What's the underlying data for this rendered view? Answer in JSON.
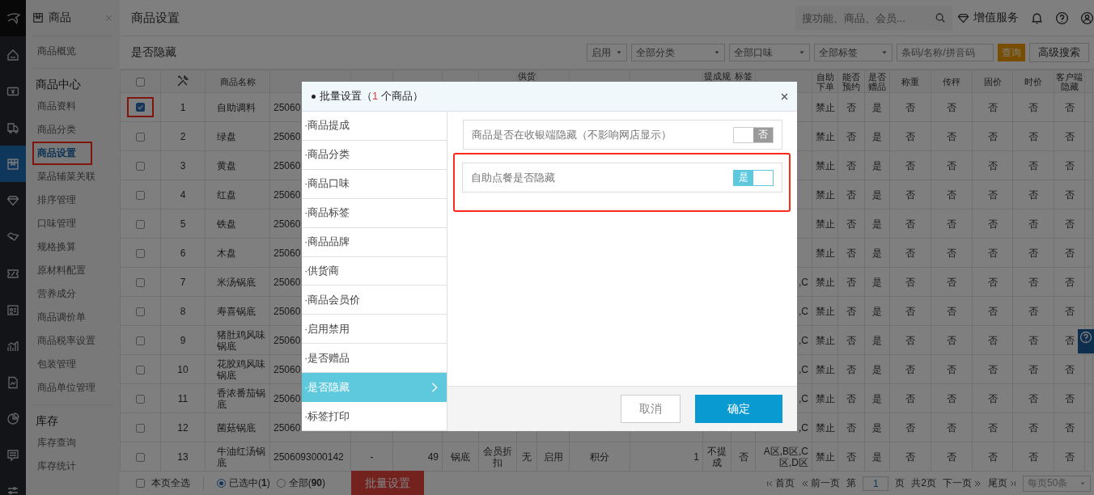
{
  "rail": [
    {
      "selected": false
    },
    {
      "selected": false
    },
    {
      "selected": false
    },
    {
      "selected": true
    },
    {
      "selected": false
    },
    {
      "selected": false
    },
    {
      "selected": false
    },
    {
      "selected": false
    },
    {
      "selected": false
    },
    {
      "selected": false
    },
    {
      "selected": false
    },
    {
      "selected": false
    },
    {
      "selected": false
    }
  ],
  "subnav": {
    "title": "商品",
    "sections": [
      {
        "items": [
          {
            "label": "商品概览",
            "selected": false,
            "highlighted": false
          }
        ]
      },
      {
        "title": "商品中心",
        "items": [
          {
            "label": "商品资料",
            "selected": false,
            "highlighted": false
          },
          {
            "label": "商品分类",
            "selected": false,
            "highlighted": false
          },
          {
            "label": "商品设置",
            "selected": true,
            "highlighted": true
          },
          {
            "label": "菜品辅菜关联",
            "selected": false,
            "highlighted": false
          },
          {
            "label": "排序管理",
            "selected": false,
            "highlighted": false
          },
          {
            "label": "口味管理",
            "selected": false,
            "highlighted": false
          },
          {
            "label": "规格换算",
            "selected": false,
            "highlighted": false
          },
          {
            "label": "原材料配置",
            "selected": false,
            "highlighted": false
          },
          {
            "label": "营养成分",
            "selected": false,
            "highlighted": false
          },
          {
            "label": "商品调价单",
            "selected": false,
            "highlighted": false
          },
          {
            "label": "商品税率设置",
            "selected": false,
            "highlighted": false
          },
          {
            "label": "包装管理",
            "selected": false,
            "highlighted": false
          },
          {
            "label": "商品单位管理",
            "selected": false,
            "highlighted": false
          }
        ]
      },
      {
        "title": "库存",
        "items": [
          {
            "label": "库存查询",
            "selected": false,
            "highlighted": false
          },
          {
            "label": "库存统计",
            "selected": false,
            "highlighted": false
          }
        ]
      }
    ]
  },
  "header": {
    "title": "商品设置",
    "search": {
      "placeholder": "搜功能、商品、会员..."
    },
    "service": "增值服务"
  },
  "toolbar": {
    "title": "是否隐藏",
    "filters": [
      "启用",
      "全部分类",
      "全部口味",
      "全部标签"
    ],
    "search": {
      "placeholder": "条码/名称/拼音码"
    },
    "query": "查询",
    "advanced": "高级搜索"
  },
  "table": {
    "columns": [
      {
        "kind": "checkbox",
        "checked": false
      },
      {
        "kind": "tools"
      },
      {
        "kind": "text",
        "label": "商品名称"
      },
      {
        "kind": "text"
      },
      {
        "kind": "text"
      },
      {
        "kind": "text"
      },
      {
        "kind": "text"
      },
      {
        "kind": "text"
      },
      {
        "kind": "cut",
        "label": "供货"
      },
      {
        "kind": "text"
      },
      {
        "kind": "text"
      },
      {
        "kind": "text"
      },
      {
        "kind": "cut",
        "label": "提成规"
      },
      {
        "kind": "cut",
        "label": "标签"
      },
      {
        "kind": "text"
      },
      {
        "kind": "text",
        "label": "自助下单"
      },
      {
        "kind": "text",
        "label": "能否预约"
      },
      {
        "kind": "text",
        "label": "是否赠品"
      },
      {
        "kind": "text",
        "label": "称重"
      },
      {
        "kind": "text",
        "label": "传秤"
      },
      {
        "kind": "text",
        "label": "固价"
      },
      {
        "kind": "text",
        "label": "时价"
      },
      {
        "kind": "text",
        "label": "客户端隐藏"
      },
      {
        "kind": "text"
      }
    ],
    "rows": [
      {
        "checked": true,
        "highlighted": true,
        "cells": [
          null,
          "1",
          "自助调料",
          "25060",
          null,
          null,
          null,
          null,
          null,
          null,
          null,
          null,
          null,
          null,
          null,
          "禁止",
          "否",
          "是",
          "否",
          "否",
          "否",
          "否",
          "否"
        ]
      },
      {
        "checked": false,
        "highlighted": false,
        "cells": [
          null,
          "2",
          "绿盘",
          "25060",
          null,
          null,
          null,
          null,
          null,
          null,
          null,
          null,
          null,
          null,
          null,
          "禁止",
          "否",
          "是",
          "否",
          "否",
          "否",
          "否",
          "否"
        ]
      },
      {
        "checked": false,
        "highlighted": false,
        "cells": [
          null,
          "3",
          "黄盘",
          "25060",
          null,
          null,
          null,
          null,
          null,
          null,
          null,
          null,
          null,
          null,
          null,
          "禁止",
          "否",
          "是",
          "否",
          "否",
          "否",
          "否",
          "否"
        ]
      },
      {
        "checked": false,
        "highlighted": false,
        "cells": [
          null,
          "4",
          "红盘",
          "25060",
          null,
          null,
          null,
          null,
          null,
          null,
          null,
          null,
          null,
          null,
          null,
          "禁止",
          "否",
          "是",
          "否",
          "否",
          "否",
          "否",
          "否"
        ]
      },
      {
        "checked": false,
        "highlighted": false,
        "cells": [
          null,
          "5",
          "铁盘",
          "25060",
          null,
          null,
          null,
          null,
          null,
          null,
          null,
          null,
          null,
          null,
          null,
          "禁止",
          "否",
          "是",
          "否",
          "否",
          "否",
          "否",
          "否"
        ]
      },
      {
        "checked": false,
        "highlighted": false,
        "cells": [
          null,
          "6",
          "木盘",
          "25060",
          null,
          null,
          null,
          null,
          null,
          null,
          null,
          null,
          null,
          null,
          null,
          "禁止",
          "否",
          "是",
          "否",
          "否",
          "否",
          "否",
          "否"
        ]
      },
      {
        "checked": false,
        "highlighted": false,
        "cells": [
          null,
          "7",
          "米汤锅底",
          "25060",
          null,
          null,
          null,
          null,
          null,
          null,
          null,
          null,
          null,
          null,
          ",C",
          "禁止",
          "否",
          "是",
          "否",
          "否",
          "否",
          "否",
          "否"
        ]
      },
      {
        "checked": false,
        "highlighted": false,
        "cells": [
          null,
          "8",
          "寿喜锅底",
          "25060",
          null,
          null,
          null,
          null,
          null,
          null,
          null,
          null,
          null,
          null,
          ",C",
          "禁止",
          "否",
          "是",
          "否",
          "否",
          "否",
          "否",
          "否"
        ]
      },
      {
        "checked": false,
        "highlighted": false,
        "cells": [
          null,
          "9",
          "猪肚鸡风味锅底",
          "25060",
          null,
          null,
          null,
          null,
          null,
          null,
          null,
          null,
          null,
          null,
          ",C",
          "禁止",
          "否",
          "是",
          "否",
          "否",
          "否",
          "否",
          "否"
        ]
      },
      {
        "checked": false,
        "highlighted": false,
        "cells": [
          null,
          "10",
          "花胶鸡风味锅底",
          "25060",
          null,
          null,
          null,
          null,
          null,
          null,
          null,
          null,
          null,
          null,
          ",C",
          "禁止",
          "否",
          "是",
          "否",
          "否",
          "否",
          "否",
          "否"
        ]
      },
      {
        "checked": false,
        "highlighted": false,
        "cells": [
          null,
          "11",
          "香浓番茄锅底",
          "25060",
          null,
          null,
          null,
          null,
          null,
          null,
          null,
          null,
          null,
          null,
          ",C",
          "禁止",
          "否",
          "是",
          "否",
          "否",
          "否",
          "否",
          "否"
        ]
      },
      {
        "checked": false,
        "highlighted": false,
        "cells": [
          null,
          "12",
          "菌菇锅底",
          "25060",
          null,
          null,
          null,
          null,
          null,
          null,
          null,
          null,
          null,
          null,
          ",C",
          "禁止",
          "否",
          "是",
          "否",
          "否",
          "否",
          "否",
          "否"
        ]
      },
      {
        "checked": false,
        "highlighted": false,
        "cells": [
          null,
          "13",
          "牛油红汤锅底",
          "2506093000142",
          "-",
          "49",
          "锅底",
          "会员折扣",
          "无",
          "启用",
          "积分",
          "1",
          "不提成",
          "否",
          "A区,B区,C区,D区",
          "禁止",
          "否",
          "是",
          "否",
          "否",
          "否",
          "否",
          "否"
        ]
      }
    ]
  },
  "footer": {
    "select_page": {
      "label": "本页全选",
      "checked": false
    },
    "scope": [
      {
        "label": "已选中(**1**)",
        "selected": true
      },
      {
        "label": "全部(**90**)",
        "selected": false
      }
    ],
    "batch": "批量设置",
    "pager": {
      "first": "首页",
      "prev": "前一页",
      "page_prefix": "第",
      "page": "1",
      "page_suffix": "页",
      "total": "共2页",
      "next": "下一页",
      "last": "尾页",
      "page_size": "每页50条"
    }
  },
  "dialog": {
    "title": "批量设置（",
    "count": "1",
    "title_end": " 个商品）",
    "menu": [
      {
        "label": "·商品提成",
        "selected": false
      },
      {
        "label": "·商品分类",
        "selected": false
      },
      {
        "label": "·商品口味",
        "selected": false
      },
      {
        "label": "·商品标签",
        "selected": false
      },
      {
        "label": "·商品品牌",
        "selected": false
      },
      {
        "label": "·供货商",
        "selected": false
      },
      {
        "label": "·商品会员价",
        "selected": false
      },
      {
        "label": "·启用禁用",
        "selected": false
      },
      {
        "label": "·是否赠品",
        "selected": false
      },
      {
        "label": "·是否隐藏",
        "selected": true
      },
      {
        "label": "·标签打印",
        "selected": false
      }
    ],
    "options": [
      {
        "label": "商品是否在收银端隐藏（不影响网店显示）",
        "on": false,
        "toggle": "否",
        "highlighted": false
      },
      {
        "label": "自助点餐是否隐藏",
        "on": true,
        "toggle": "是",
        "highlighted": true
      }
    ],
    "cancel": "取消",
    "confirm": "确定"
  }
}
